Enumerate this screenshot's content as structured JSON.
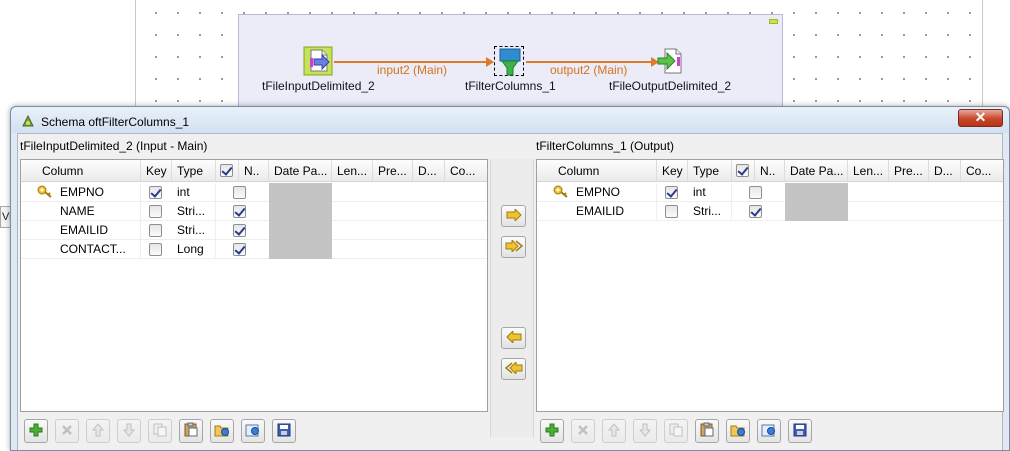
{
  "designer": {
    "side_tab_label": "Vi",
    "components": [
      {
        "name": "tFileInputDelimited_2",
        "icon": "file-input-icon"
      },
      {
        "name": "tFilterColumns_1",
        "icon": "filter-columns-icon"
      },
      {
        "name": "tFileOutputDelimited_2",
        "icon": "file-output-icon"
      }
    ],
    "links": [
      {
        "label": "input2 (Main)"
      },
      {
        "label": "output2 (Main)"
      }
    ],
    "link_color": "#e07a2b",
    "subjob_color": "#ececf9"
  },
  "dialog": {
    "title": "Schema oftFilterColumns_1",
    "close_label": "✕",
    "input_panel": {
      "title": "tFileInputDelimited_2 (Input - Main)",
      "columns": [
        "Column",
        "Key",
        "Type",
        "",
        "N..",
        "Date Pa...",
        "Len...",
        "Pre...",
        "D...",
        "Co..."
      ],
      "rows": [
        {
          "column": "EMPNO",
          "key": true,
          "type": "int",
          "nullable": false
        },
        {
          "column": "NAME",
          "key": false,
          "type": "Stri...",
          "nullable": true
        },
        {
          "column": "EMAILID",
          "key": false,
          "type": "Stri...",
          "nullable": true
        },
        {
          "column": "CONTACT...",
          "key": false,
          "type": "Long",
          "nullable": true
        }
      ]
    },
    "output_panel": {
      "title": "tFilterColumns_1 (Output)",
      "columns": [
        "Column",
        "Key",
        "Type",
        "",
        "N..",
        "Date Pa...",
        "Len...",
        "Pre...",
        "D...",
        "Co..."
      ],
      "rows": [
        {
          "column": "EMPNO",
          "key": true,
          "type": "int",
          "nullable": false
        },
        {
          "column": "EMAILID",
          "key": false,
          "type": "Stri...",
          "nullable": true
        }
      ]
    },
    "transfer_buttons": [
      "copy-selected-right-icon",
      "copy-all-right-icon",
      "copy-selected-left-icon",
      "copy-all-left-icon"
    ],
    "toolbar_buttons": [
      "add-icon",
      "remove-icon",
      "move-up-icon",
      "move-down-icon",
      "copy-icon",
      "paste-icon",
      "import-icon",
      "export-icon",
      "save-icon"
    ],
    "toolbar_disabled": [
      false,
      true,
      true,
      true,
      true,
      false,
      false,
      false,
      false
    ]
  }
}
